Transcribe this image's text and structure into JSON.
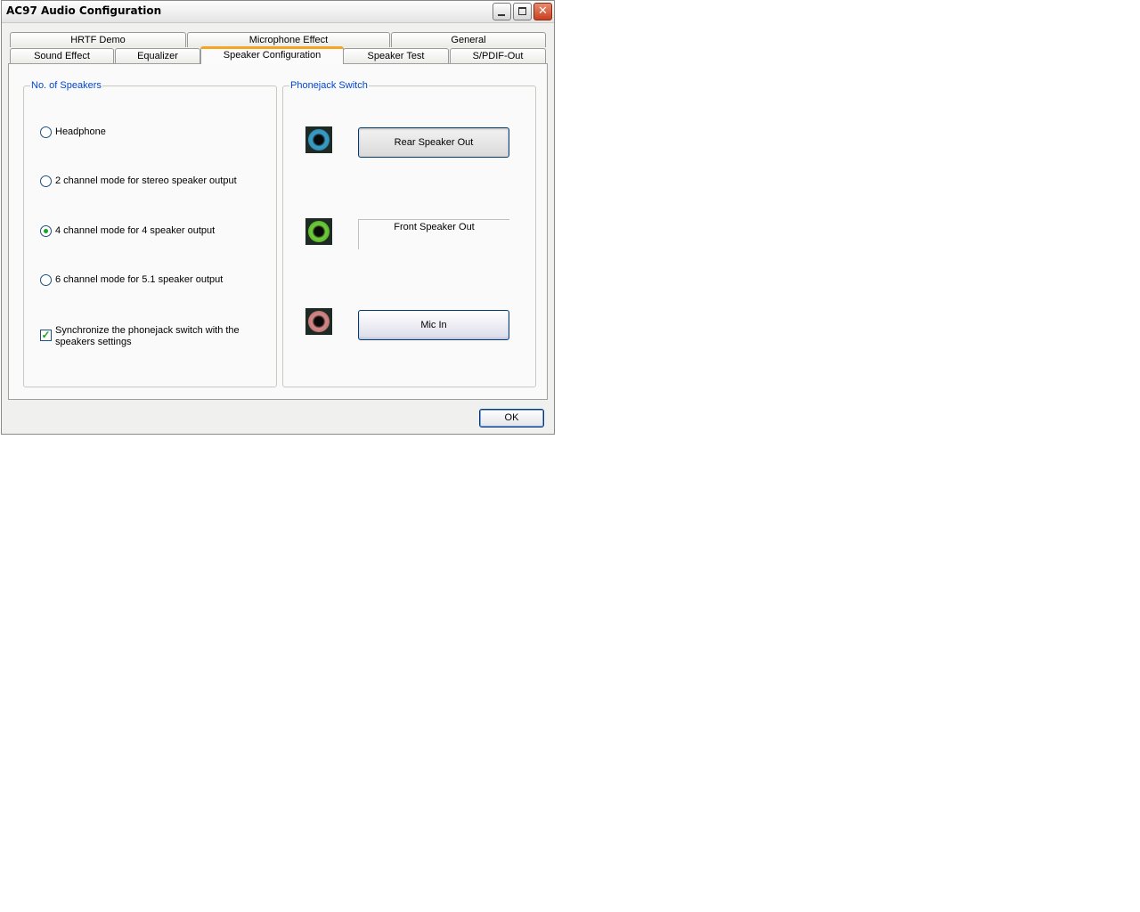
{
  "window": {
    "title": "AC97 Audio Configuration"
  },
  "tabs": {
    "row1": [
      {
        "label": "HRTF Demo"
      },
      {
        "label": "Microphone Effect"
      },
      {
        "label": "General"
      }
    ],
    "row2": [
      {
        "label": "Sound Effect"
      },
      {
        "label": "Equalizer"
      },
      {
        "label": "Speaker Configuration",
        "active": true
      },
      {
        "label": "Speaker Test"
      },
      {
        "label": "S/PDIF-Out"
      }
    ]
  },
  "speakers": {
    "group_label": "No. of Speakers",
    "options": [
      {
        "label": "Headphone",
        "checked": false
      },
      {
        "label": "2 channel mode for stereo speaker output",
        "checked": false
      },
      {
        "label": "4 channel mode for 4 speaker output",
        "checked": true
      },
      {
        "label": "6 channel mode for 5.1 speaker output",
        "checked": false
      }
    ],
    "sync_label_line1": "Synchronize the phonejack switch with the",
    "sync_label_line2": "speakers settings",
    "sync_checked": true
  },
  "phonejack": {
    "group_label": "Phonejack Switch",
    "jacks": [
      {
        "color": "#3a9fc8",
        "button": "Rear Speaker Out"
      },
      {
        "color": "#6fcf3a",
        "button": "Front Speaker Out"
      },
      {
        "color": "#d48a88",
        "button": "Mic In"
      }
    ]
  },
  "footer": {
    "ok_label": "OK"
  }
}
